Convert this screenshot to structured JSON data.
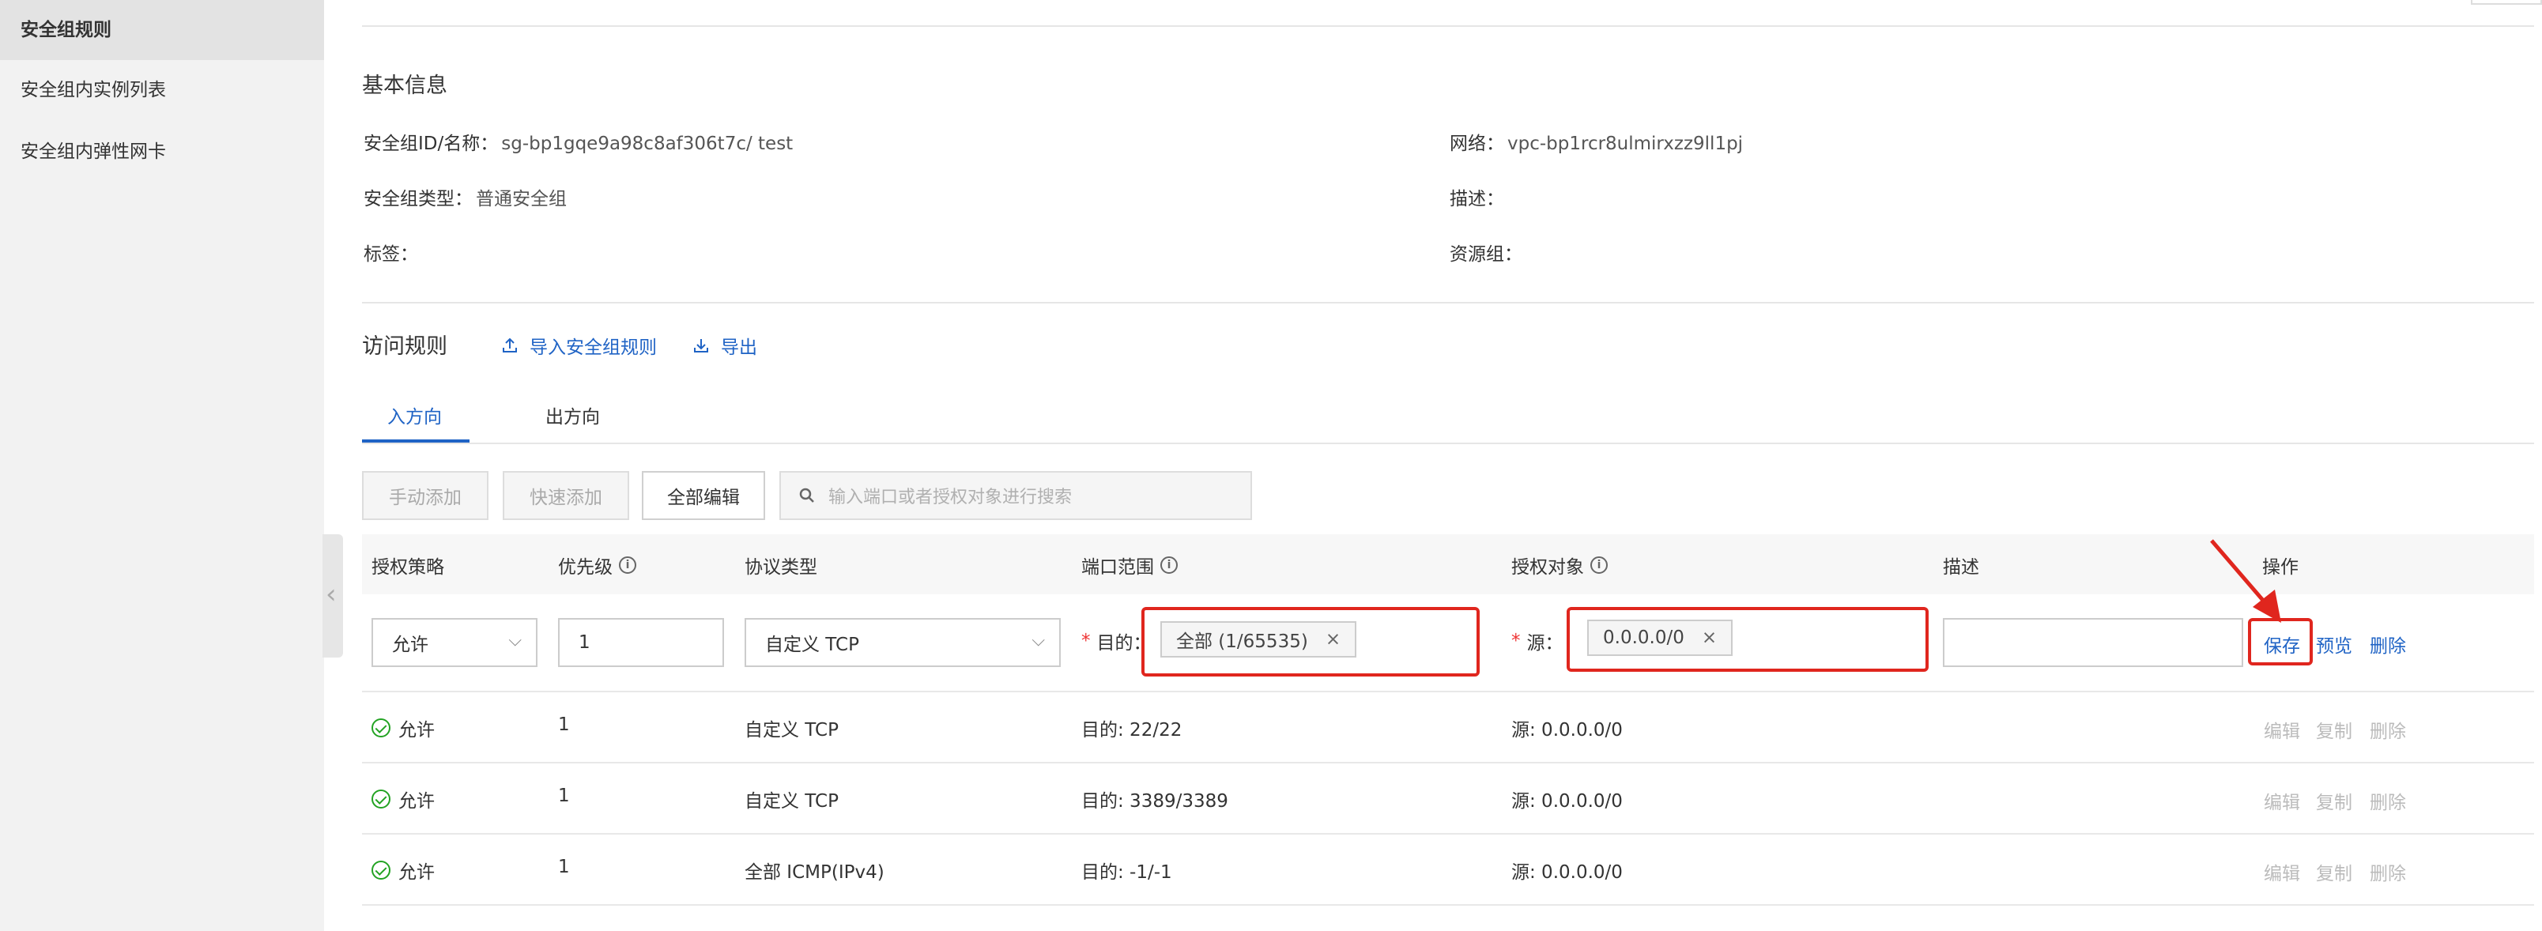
{
  "sidebar": {
    "items": [
      {
        "label": "安全组规则"
      },
      {
        "label": "安全组内实例列表"
      },
      {
        "label": "安全组内弹性网卡"
      }
    ]
  },
  "basic_info": {
    "title": "基本信息",
    "sg_id_label": "安全组ID/名称：",
    "sg_id_value": "sg-bp1gqe9a98c8af306t7c/ test",
    "network_label": "网络：",
    "network_value": "vpc-bp1rcr8ulmirxzz9ll1pj",
    "sg_type_label": "安全组类型：",
    "sg_type_value": "普通安全组",
    "desc_label": "描述：",
    "tags_label": "标签：",
    "resource_group_label": "资源组："
  },
  "access_rules": {
    "title": "访问规则",
    "import_link": "导入安全组规则",
    "export_link": "导出"
  },
  "tabs": [
    {
      "label": "入方向"
    },
    {
      "label": "出方向"
    }
  ],
  "toolbar": {
    "manual_add": "手动添加",
    "quick_add": "快速添加",
    "edit_all": "全部编辑",
    "search_placeholder": "输入端口或者授权对象进行搜索"
  },
  "table": {
    "headers": {
      "policy": "授权策略",
      "priority": "优先级",
      "protocol": "协议类型",
      "port_range": "端口范围",
      "auth_object": "授权对象",
      "description": "描述",
      "actions": "操作"
    },
    "edit_row": {
      "policy": "允许",
      "priority": "1",
      "protocol": "自定义 TCP",
      "dest_label": "目的：",
      "dest_tag": "全部 (1/65535)",
      "source_label": "源：",
      "source_tag": "0.0.0.0/0",
      "description": "",
      "save": "保存",
      "preview": "预览",
      "delete": "删除"
    },
    "rows": [
      {
        "policy": "允许",
        "priority": "1",
        "protocol": "自定义 TCP",
        "port": "目的: 22/22",
        "source": "源: 0.0.0.0/0",
        "edit": "编辑",
        "copy": "复制",
        "delete": "删除"
      },
      {
        "policy": "允许",
        "priority": "1",
        "protocol": "自定义 TCP",
        "port": "目的: 3389/3389",
        "source": "源: 0.0.0.0/0",
        "edit": "编辑",
        "copy": "复制",
        "delete": "删除"
      },
      {
        "policy": "允许",
        "priority": "1",
        "protocol": "全部 ICMP(IPv4)",
        "port": "目的: -1/-1",
        "source": "源: 0.0.0.0/0",
        "edit": "编辑",
        "copy": "复制",
        "delete": "删除"
      }
    ]
  },
  "icons": {
    "upload": "upload-icon",
    "download": "download-icon",
    "search": "search-icon",
    "info": "info-icon",
    "chevron": "chevron-down-icon",
    "check": "check-circle-icon",
    "close": "close-icon",
    "arrow": "red-arrow-annotation"
  },
  "colors": {
    "accent": "#1f63c5",
    "highlight": "#e0261e",
    "success": "#23a323"
  }
}
